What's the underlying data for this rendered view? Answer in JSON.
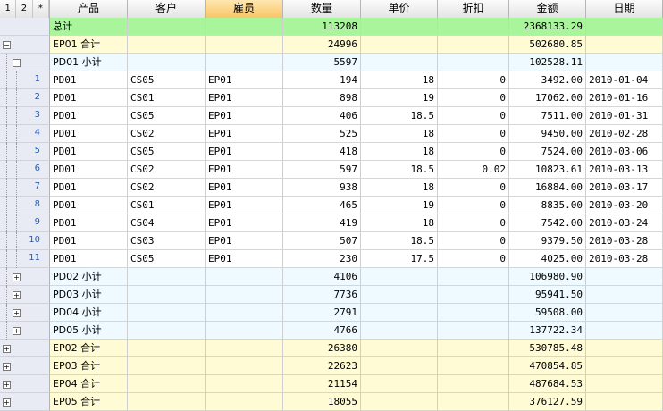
{
  "header": {
    "levels": [
      "1",
      "2",
      "*"
    ],
    "columns": [
      "产品",
      "客户",
      "雇员",
      "数量",
      "单价",
      "折扣",
      "金额",
      "日期"
    ]
  },
  "rows": [
    {
      "type": "total",
      "c": [
        "总计",
        "",
        "",
        "113208",
        "",
        "",
        "2368133.29",
        ""
      ]
    },
    {
      "type": "ep",
      "toggle": "−",
      "c": [
        "EP01 合计",
        "",
        "",
        "24996",
        "",
        "",
        "502680.85",
        ""
      ]
    },
    {
      "type": "pd",
      "toggle": "−",
      "c": [
        "PD01 小计",
        "",
        "",
        "5597",
        "",
        "",
        "102528.11",
        ""
      ]
    },
    {
      "type": "detail",
      "rn": "1",
      "c": [
        "PD01",
        "CS05",
        "EP01",
        "194",
        "18",
        "0",
        "3492.00",
        "2010-01-04"
      ]
    },
    {
      "type": "detail",
      "rn": "2",
      "c": [
        "PD01",
        "CS01",
        "EP01",
        "898",
        "19",
        "0",
        "17062.00",
        "2010-01-16"
      ]
    },
    {
      "type": "detail",
      "rn": "3",
      "c": [
        "PD01",
        "CS05",
        "EP01",
        "406",
        "18.5",
        "0",
        "7511.00",
        "2010-01-31"
      ]
    },
    {
      "type": "detail",
      "rn": "4",
      "c": [
        "PD01",
        "CS02",
        "EP01",
        "525",
        "18",
        "0",
        "9450.00",
        "2010-02-28"
      ]
    },
    {
      "type": "detail",
      "rn": "5",
      "c": [
        "PD01",
        "CS05",
        "EP01",
        "418",
        "18",
        "0",
        "7524.00",
        "2010-03-06"
      ]
    },
    {
      "type": "detail",
      "rn": "6",
      "c": [
        "PD01",
        "CS02",
        "EP01",
        "597",
        "18.5",
        "0.02",
        "10823.61",
        "2010-03-13"
      ]
    },
    {
      "type": "detail",
      "rn": "7",
      "c": [
        "PD01",
        "CS02",
        "EP01",
        "938",
        "18",
        "0",
        "16884.00",
        "2010-03-17"
      ]
    },
    {
      "type": "detail",
      "rn": "8",
      "c": [
        "PD01",
        "CS01",
        "EP01",
        "465",
        "19",
        "0",
        "8835.00",
        "2010-03-20"
      ]
    },
    {
      "type": "detail",
      "rn": "9",
      "c": [
        "PD01",
        "CS04",
        "EP01",
        "419",
        "18",
        "0",
        "7542.00",
        "2010-03-24"
      ]
    },
    {
      "type": "detail",
      "rn": "10",
      "c": [
        "PD01",
        "CS03",
        "EP01",
        "507",
        "18.5",
        "0",
        "9379.50",
        "2010-03-28"
      ]
    },
    {
      "type": "detail",
      "rn": "11",
      "c": [
        "PD01",
        "CS05",
        "EP01",
        "230",
        "17.5",
        "0",
        "4025.00",
        "2010-03-28"
      ]
    },
    {
      "type": "pd",
      "toggle": "+",
      "c": [
        "PD02 小计",
        "",
        "",
        "4106",
        "",
        "",
        "106980.90",
        ""
      ]
    },
    {
      "type": "pd",
      "toggle": "+",
      "c": [
        "PD03 小计",
        "",
        "",
        "7736",
        "",
        "",
        "95941.50",
        ""
      ]
    },
    {
      "type": "pd",
      "toggle": "+",
      "c": [
        "PD04 小计",
        "",
        "",
        "2791",
        "",
        "",
        "59508.00",
        ""
      ]
    },
    {
      "type": "pd",
      "toggle": "+",
      "c": [
        "PD05 小计",
        "",
        "",
        "4766",
        "",
        "",
        "137722.34",
        ""
      ]
    },
    {
      "type": "ep",
      "toggle": "+",
      "c": [
        "EP02 合计",
        "",
        "",
        "26380",
        "",
        "",
        "530785.48",
        ""
      ]
    },
    {
      "type": "ep",
      "toggle": "+",
      "c": [
        "EP03 合计",
        "",
        "",
        "22623",
        "",
        "",
        "470854.85",
        ""
      ]
    },
    {
      "type": "ep",
      "toggle": "+",
      "c": [
        "EP04 合计",
        "",
        "",
        "21154",
        "",
        "",
        "487684.53",
        ""
      ]
    },
    {
      "type": "ep",
      "toggle": "+",
      "c": [
        "EP05 合计",
        "",
        "",
        "18055",
        "",
        "",
        "376127.59",
        ""
      ]
    }
  ]
}
